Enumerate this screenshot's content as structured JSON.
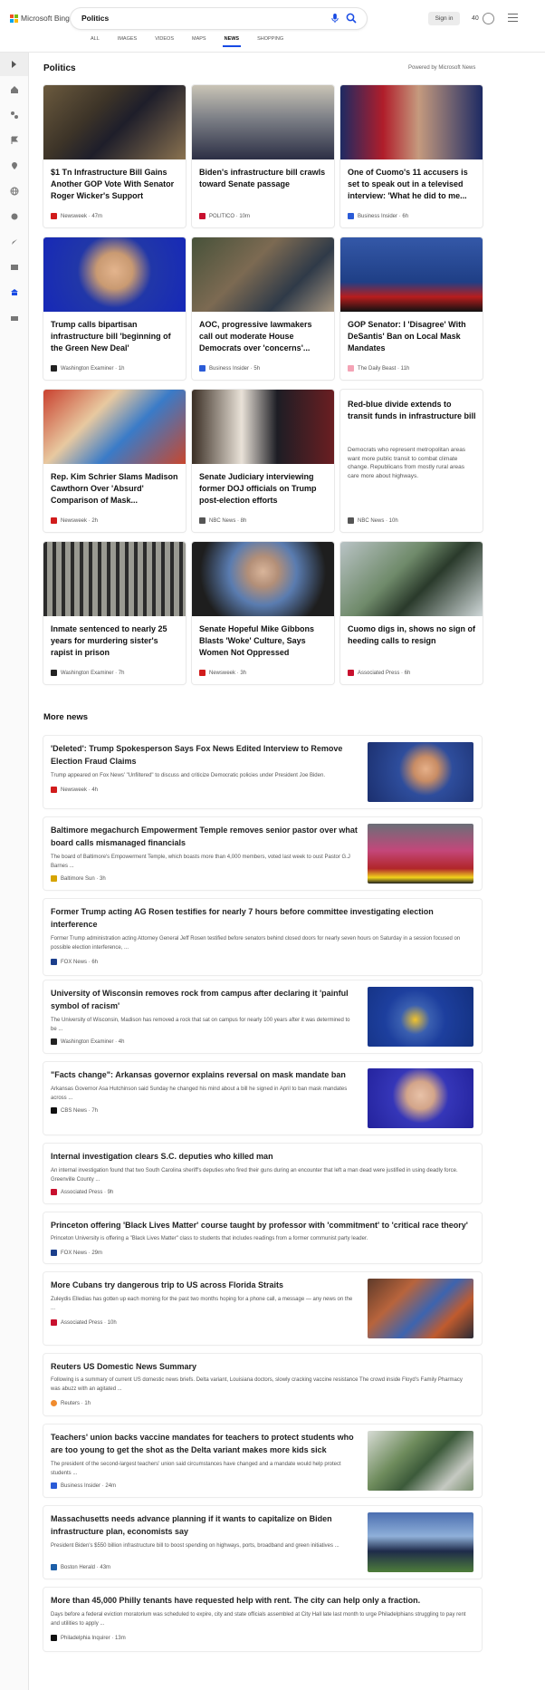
{
  "header": {
    "brand": "Microsoft Bing",
    "query": "Politics",
    "signin": "Sign in",
    "rewards": "40",
    "tabs": [
      "ALL",
      "IMAGES",
      "VIDEOS",
      "MAPS",
      "NEWS",
      "SHOPPING"
    ],
    "active_tab": "NEWS"
  },
  "section": {
    "title": "Politics",
    "powered": "Powered by Microsoft News"
  },
  "cards": [
    {
      "title": "$1 Tn Infrastructure Bill Gains Another GOP Vote With Senator Roger Wicker's Support",
      "source": "Newsweek · 47m",
      "fav": "#d11c1c"
    },
    {
      "title": "Biden's infrastructure bill crawls toward Senate passage",
      "source": "POLITICO · 10m",
      "fav": "#c8102e"
    },
    {
      "title": "One of Cuomo's 11 accusers is set to speak out in a televised interview: 'What he did to me...",
      "source": "Business Insider · 6h",
      "fav": "#2a5bd7"
    },
    {
      "title": "Trump calls bipartisan infrastructure bill 'beginning of the Green New Deal'",
      "source": "Washington Examiner · 1h",
      "fav": "#222"
    },
    {
      "title": "AOC, progressive lawmakers call out moderate House Democrats over 'concerns'...",
      "source": "Business Insider · 5h",
      "fav": "#2a5bd7"
    },
    {
      "title": "GOP Senator: I 'Disagree' With DeSantis' Ban on Local Mask Mandates",
      "source": "The Daily Beast · 11h",
      "fav": "#f4a3b5"
    },
    {
      "title": "Rep. Kim Schrier Slams Madison Cawthorn Over 'Absurd' Comparison of Mask...",
      "source": "Newsweek · 2h",
      "fav": "#d11c1c"
    },
    {
      "title": "Senate Judiciary interviewing former DOJ officials on Trump post-election efforts",
      "source": "NBC News · 8h",
      "fav": "#555"
    },
    {
      "title": "Red-blue divide extends to transit funds in infrastructure bill",
      "snippet": "Democrats who represent metropolitan areas want more public transit to combat climate change. Republicans from mostly rural areas care more about highways.",
      "source": "NBC News · 10h",
      "fav": "#555"
    },
    {
      "title": "Inmate sentenced to nearly 25 years for murdering sister's rapist in prison",
      "source": "Washington Examiner · 7h",
      "fav": "#222"
    },
    {
      "title": "Senate Hopeful Mike Gibbons Blasts 'Woke' Culture, Says Women Not Oppressed",
      "source": "Newsweek · 3h",
      "fav": "#d11c1c"
    },
    {
      "title": "Cuomo digs in, shows no sign of heeding calls to resign",
      "source": "Associated Press · 6h",
      "fav": "#c8102e"
    }
  ],
  "more_title": "More news",
  "news": [
    {
      "title": "'Deleted': Trump Spokesperson Says Fox News Edited Interview to Remove Election Fraud Claims",
      "snippet": "Trump appeared on Fox News' \"Unfiltered\" to discuss and criticize Democratic policies under President Joe Biden.",
      "source": "Newsweek · 4h",
      "fav": "#d11c1c"
    },
    {
      "title": "Baltimore megachurch Empowerment Temple removes senior pastor over what board calls mismanaged financials",
      "snippet": "The board of Baltimore's Empowerment Temple, which boasts more than 4,000 members, voted last week to oust Pastor G.J Barnes ...",
      "source": "Baltimore Sun · 3h",
      "fav": "#d6a400"
    },
    {
      "title": "Former Trump acting AG Rosen testifies for nearly 7 hours before committee investigating election interference",
      "snippet": "Former Trump administration acting Attorney General Jeff Rosen testified before senators behind closed doors for nearly seven hours on Saturday in a session focused on possible election interference, ...",
      "source": "FOX News · 6h",
      "fav": "#1c3f8c"
    },
    {
      "title": "University of Wisconsin removes rock from campus after declaring it 'painful symbol of racism'",
      "snippet": "The University of Wisconsin, Madison has removed a rock that sat on campus for nearly 100 years after it was determined to be ...",
      "source": "Washington Examiner · 4h",
      "fav": "#222"
    },
    {
      "title": "\"Facts change\": Arkansas governor explains reversal on mask mandate ban",
      "snippet": "Arkansas Governor Asa Hutchinson said Sunday he changed his mind about a bill he signed in April to ban mask mandates across ...",
      "source": "CBS News · 7h",
      "fav": "#111"
    },
    {
      "title": "Internal investigation clears S.C. deputies who killed man",
      "snippet": "An internal investigation found that two South Carolina sheriff's deputies who fired their guns during an encounter that left a man dead were justified in using deadly force. Greenville County ...",
      "source": "Associated Press · 9h",
      "fav": "#c8102e"
    },
    {
      "title": "Princeton offering 'Black Lives Matter' course taught by professor with 'commitment' to 'critical race theory'",
      "snippet": "Princeton University is offering a \"Black Lives Matter\" class to students that includes readings from a former communist party leader.",
      "source": "FOX News · 29m",
      "fav": "#1c3f8c"
    },
    {
      "title": "More Cubans try dangerous trip to US across Florida Straits",
      "snippet": "Zuleydis Elledias has gotten up each morning for the past two months hoping for a phone call, a message — any news on the ...",
      "source": "Associated Press · 10h",
      "fav": "#c8102e"
    },
    {
      "title": "Reuters US Domestic News Summary",
      "snippet": "Following is a summary of current US domestic news briefs. Delta variant, Louisiana doctors, slowly cracking vaccine resistance The crowd inside Floyd's Family Pharmacy was abuzz with an agitated ...",
      "source": "Reuters · 1h",
      "fav": "#f08b2e"
    },
    {
      "title": "Teachers' union backs vaccine mandates for teachers to protect students who are too young to get the shot as the Delta variant makes more kids sick",
      "snippet": "The president of the second-largest teachers' union said circumstances have changed and a mandate would help protect students ...",
      "source": "Business Insider · 24m",
      "fav": "#2a5bd7"
    },
    {
      "title": "Massachusetts needs advance planning if it wants to capitalize on Biden infrastructure plan, economists say",
      "snippet": "President Biden's $550 billion infrastructure bill to boost spending on highways, ports, broadband and green initiatives ...",
      "source": "Boston Herald · 43m",
      "fav": "#1d5fa8"
    },
    {
      "title": "More than 45,000 Philly tenants have requested help with rent. The city can help only a fraction.",
      "snippet": "Days before a federal eviction moratorium was scheduled to expire, city and state officials assembled at City Hall late last month to urge Philadelphians struggling to pay rent and utilities to apply ...",
      "source": "Philadelphia Inquirer · 13m",
      "fav": "#111"
    }
  ]
}
